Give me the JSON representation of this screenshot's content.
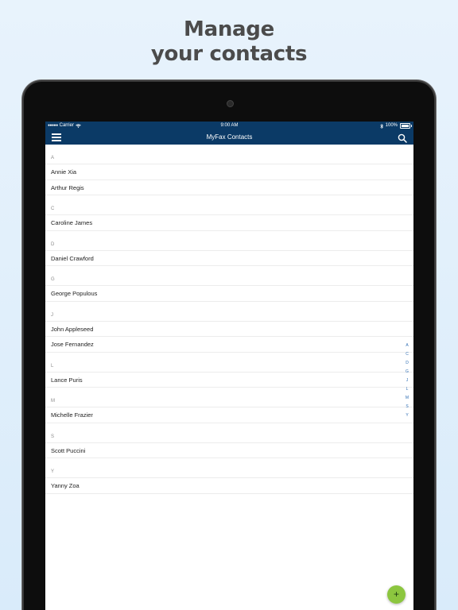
{
  "headline": {
    "line1": "Manage",
    "line2": "your contacts"
  },
  "status_bar": {
    "carrier": "Carrier",
    "time": "9:00 AM",
    "battery": "100%"
  },
  "nav": {
    "title": "MyFax Contacts"
  },
  "contacts": {
    "sections": [
      {
        "letter": "A",
        "names": [
          "Annie Xia",
          "Arthur Regis"
        ]
      },
      {
        "letter": "C",
        "names": [
          "Caroline James"
        ]
      },
      {
        "letter": "D",
        "names": [
          "Daniel Crawford"
        ]
      },
      {
        "letter": "G",
        "names": [
          "George Populous"
        ]
      },
      {
        "letter": "J",
        "names": [
          "John Appleseed",
          "Jose Fernandez"
        ]
      },
      {
        "letter": "L",
        "names": [
          "Lance Puris"
        ]
      },
      {
        "letter": "M",
        "names": [
          "Michelle Frazier"
        ]
      },
      {
        "letter": "S",
        "names": [
          "Scott Puccini"
        ]
      },
      {
        "letter": "Y",
        "names": [
          "Yanny Zoa"
        ]
      }
    ]
  },
  "index_letters": [
    "A",
    "C",
    "D",
    "G",
    "J",
    "L",
    "M",
    "S",
    "Y"
  ],
  "fab": {
    "label": "+"
  },
  "colors": {
    "nav_bg": "#0b3a66",
    "fab_bg": "#8cc63f",
    "index_text": "#2e6db4"
  }
}
